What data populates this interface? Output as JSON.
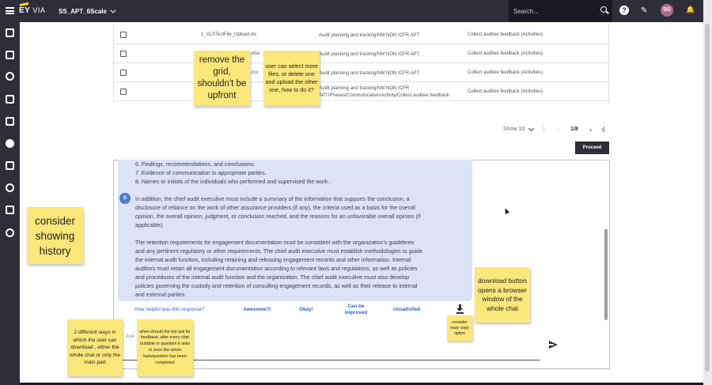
{
  "header": {
    "logo_ey": "EY",
    "logo_via": "VIA",
    "project": "SS_APT_6Scale",
    "search_placeholder": "Search...",
    "help_glyph": "?",
    "edit_glyph": "✎",
    "user_initials": "SG",
    "notification_glyph": "🔔"
  },
  "files_table": {
    "rows": [
      {
        "file": "1_XLSTestFile_Upload.xls",
        "path": "Audit planning and tracking/NM NON ICFR APT",
        "activity": "Collect auditee feedback (Activities)"
      },
      {
        "file": ".xlsx",
        "path": "Audit planning and tracking/NM NON ICFR APT",
        "activity": "Collect auditee feedback (Activities)"
      },
      {
        "file": ".csv",
        "path": "Audit planning and tracking/NM NON ICFR APT",
        "activity": "Collect auditee feedback (Activities)"
      },
      {
        "file": "",
        "path": "Audit planning and tracking/NM NON ICFR APT/Phases/Communication/Activity/Collect auditee feedback",
        "activity": "Collect auditee feedback (Activities)"
      }
    ]
  },
  "pagination": {
    "show_label": "Show 10",
    "first": "|‹",
    "prev": "‹",
    "pages": "1/8",
    "next": "›",
    "last": "›|",
    "proceed_label": "Proceed"
  },
  "chat": {
    "list_items": [
      "6. Findings, recommendations, and conclusions.",
      "7. Evidence of communication to appropriate parties.",
      "8. Names or initials of the individuals who performed and supervised the work."
    ],
    "avatar_letter": "G",
    "paragraph1_lines": [
      "In addition, the chief audit executive must include a summary of the information that supports the conclusion, a",
      "disclosure of reliance on the work of other assurance providers (if any), the criteria used as a basis for the overall",
      "opinion, the overall opinion, judgment, or conclusion reached, and the reasons for an unfavorable overall opinion (if",
      "applicable)."
    ],
    "paragraph2_lines": [
      "The retention requirements for engagement documentation must be consistent with the organization's guidelines",
      "and any pertinent regulatory or other requirements. The chief audit executive must establish methodologies to guide",
      "the internal audit function, including retaining and releasing engagement records and other information. Internal",
      "auditors must retain all engagement documentation according to relevant laws and regulations, as well as policies",
      "and procedures of the internal audit function and the organization. The chief audit executive must also develop",
      "policies governing the custody and retention of consulting engagement records, as well as their release to internal",
      "and external parties."
    ],
    "feedback_question": "How helpful was this response?",
    "feedback_options": [
      "Awesome!!!",
      "Okay!",
      "Can be improved",
      "Unsatisfied"
    ],
    "ask_placeholder": "Ask"
  },
  "sticky_notes": {
    "grid": "remove the grid, shouldn't be upfront",
    "select_files": "user can select more files, or delete one and upload the other one, how to do it?",
    "history": "consider showing history",
    "download_opens": "download button opens a browser window of the whole chat",
    "easy_copy": "consider easy copy option",
    "two_ways": "2 different ways in which the user can download , either the whole chat or only the main part",
    "feedback_when": "when should the bot ask for feedback, after every chat bubbble or question it asks or once the whole task/question has been completed"
  },
  "colors": {
    "topbar": "#2e2e38",
    "accent_yellow": "#ffe600",
    "sticky": "#fbe77a",
    "chat_bubble": "#dde3f5",
    "link_blue": "#2f5fc4"
  }
}
